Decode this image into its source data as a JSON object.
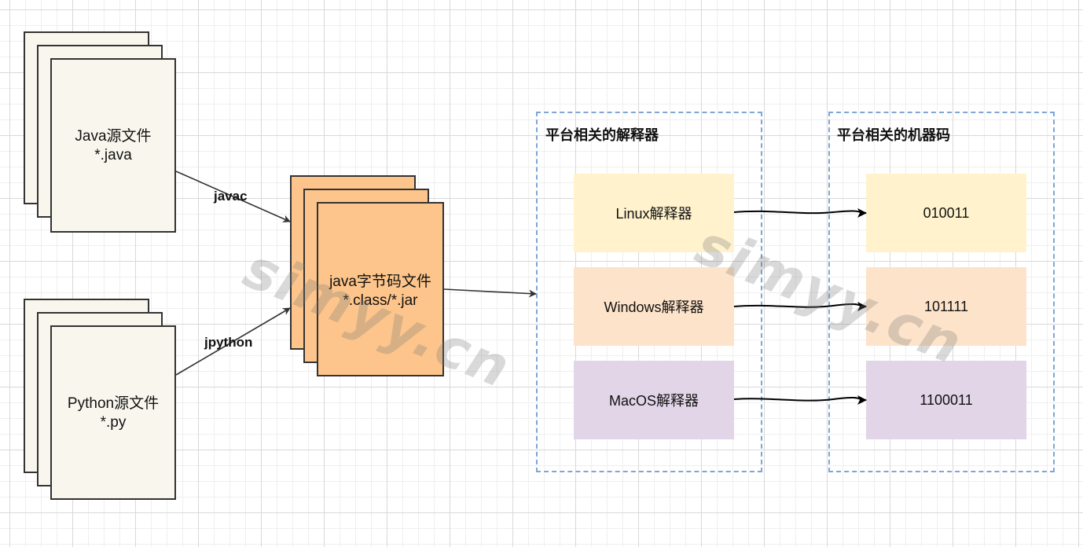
{
  "sources": [
    {
      "name": "Java源文件",
      "ext": "*.java"
    },
    {
      "name": "Python源文件",
      "ext": "*.py"
    }
  ],
  "compilers": {
    "java": "javac",
    "python": "jpython"
  },
  "bytecode": {
    "name": "java字节码文件",
    "ext": "*.class/*.jar"
  },
  "interpreters": {
    "title": "平台相关的解释器",
    "items": [
      "Linux解释器",
      "Windows解释器",
      "MacOS解释器"
    ]
  },
  "machine_code": {
    "title": "平台相关的机器码",
    "items": [
      "010011",
      "101111",
      "1100011"
    ]
  },
  "watermark": "simyy.cn",
  "colors": {
    "source_fill": "#f9f7ed",
    "bytecode_fill": "#fdc58b",
    "linux": "#fff2cc",
    "windows": "#fde3c9",
    "macos": "#e1d5e7",
    "frame_border": "#7ea6d4"
  }
}
